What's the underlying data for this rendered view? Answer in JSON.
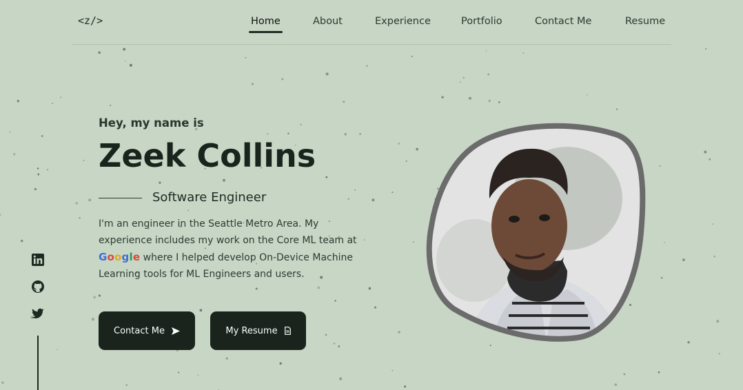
{
  "logo": {
    "text": "<z/>"
  },
  "nav": {
    "items": [
      {
        "label": "Home",
        "active": true
      },
      {
        "label": "About",
        "active": false
      },
      {
        "label": "Experience",
        "active": false
      },
      {
        "label": "Portfolio",
        "active": false
      },
      {
        "label": "Contact Me",
        "active": false
      },
      {
        "label": "Resume",
        "active": false
      }
    ]
  },
  "hero": {
    "greeting": "Hey, my name is",
    "name": "Zeek Collins",
    "role": "Software Engineer",
    "bio_part1": "I'm an engineer in the Seattle Metro Area. My experience includes my work on the Core ML team at",
    "bio_brand": [
      "G",
      "o",
      "o",
      "g",
      "l",
      "e"
    ],
    "bio_part2": "where I helped develop On-Device Machine Learning tools for ML Engineers and users."
  },
  "buttons": {
    "contact_label": "Contact Me",
    "resume_label": "My Resume"
  },
  "social": {
    "icons": [
      "linkedin-icon",
      "github-icon",
      "twitter-icon"
    ]
  },
  "colors": {
    "background": "#c7d6c5",
    "button_bg": "#1a241d",
    "text_dark": "#18241c"
  }
}
